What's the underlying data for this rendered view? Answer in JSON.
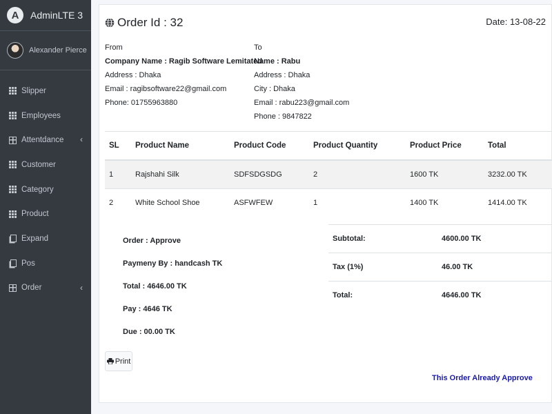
{
  "brand": {
    "logo_letter": "A",
    "name": "AdminLTE 3"
  },
  "user": {
    "name": "Alexander Pierce"
  },
  "sidebar": {
    "items": [
      {
        "label": "Slipper",
        "icon": "grid-icon"
      },
      {
        "label": "Employees",
        "icon": "grid-icon"
      },
      {
        "label": "Attentdance",
        "icon": "table-icon",
        "has_chevron": true
      },
      {
        "label": "Customer",
        "icon": "grid-icon"
      },
      {
        "label": "Category",
        "icon": "grid-icon"
      },
      {
        "label": "Product",
        "icon": "grid-icon"
      },
      {
        "label": "Expand",
        "icon": "copy-icon"
      },
      {
        "label": "Pos",
        "icon": "copy-icon"
      },
      {
        "label": "Order",
        "icon": "table-icon",
        "has_chevron": true
      }
    ],
    "chevron": "‹"
  },
  "order": {
    "title": "Order Id : 32",
    "date": "Date: 13-08-22"
  },
  "from": {
    "heading": "From",
    "company": "Company Name : Ragib Software Lemitated",
    "address": "Address : Dhaka",
    "email": "Email : ragibsoftware22@gmail.com",
    "phone": "Phone: 01755963880"
  },
  "to": {
    "heading": "To",
    "name": "Name : Rabu",
    "address": "Address : Dhaka",
    "city": "City : Dhaka",
    "email": "Email : rabu223@gmail.com",
    "phone": "Phone : 9847822"
  },
  "items_table": {
    "headers": [
      "SL",
      "Product Name",
      "Product Code",
      "Product Quantity",
      "Product Price",
      "Total"
    ],
    "rows": [
      [
        "1",
        "Rajshahi Silk",
        "SDFSDGSDG",
        "2",
        "1600 TK",
        "3232.00 TK"
      ],
      [
        "2",
        "White School Shoe",
        "ASFWFEW",
        "1",
        "1400 TK",
        "1414.00 TK"
      ]
    ]
  },
  "summary": {
    "status": "Order : Approve",
    "payment": "Paymeny By : handcash TK",
    "total": "Total : 4646.00 TK",
    "pay": "Pay : 4646 TK",
    "due": "Due : 00.00 TK"
  },
  "totals": {
    "subtotal_label": "Subtotal:",
    "subtotal_value": "4600.00 TK",
    "tax_label": "Tax (1%)",
    "tax_value": "46.00 TK",
    "total_label": "Total:",
    "total_value": "4646.00 TK"
  },
  "actions": {
    "print_label": "Print"
  },
  "approve_note": "This Order Already Approve",
  "colors": {
    "sidebar_bg": "#343a40",
    "approve_text": "#1a1aa6"
  }
}
